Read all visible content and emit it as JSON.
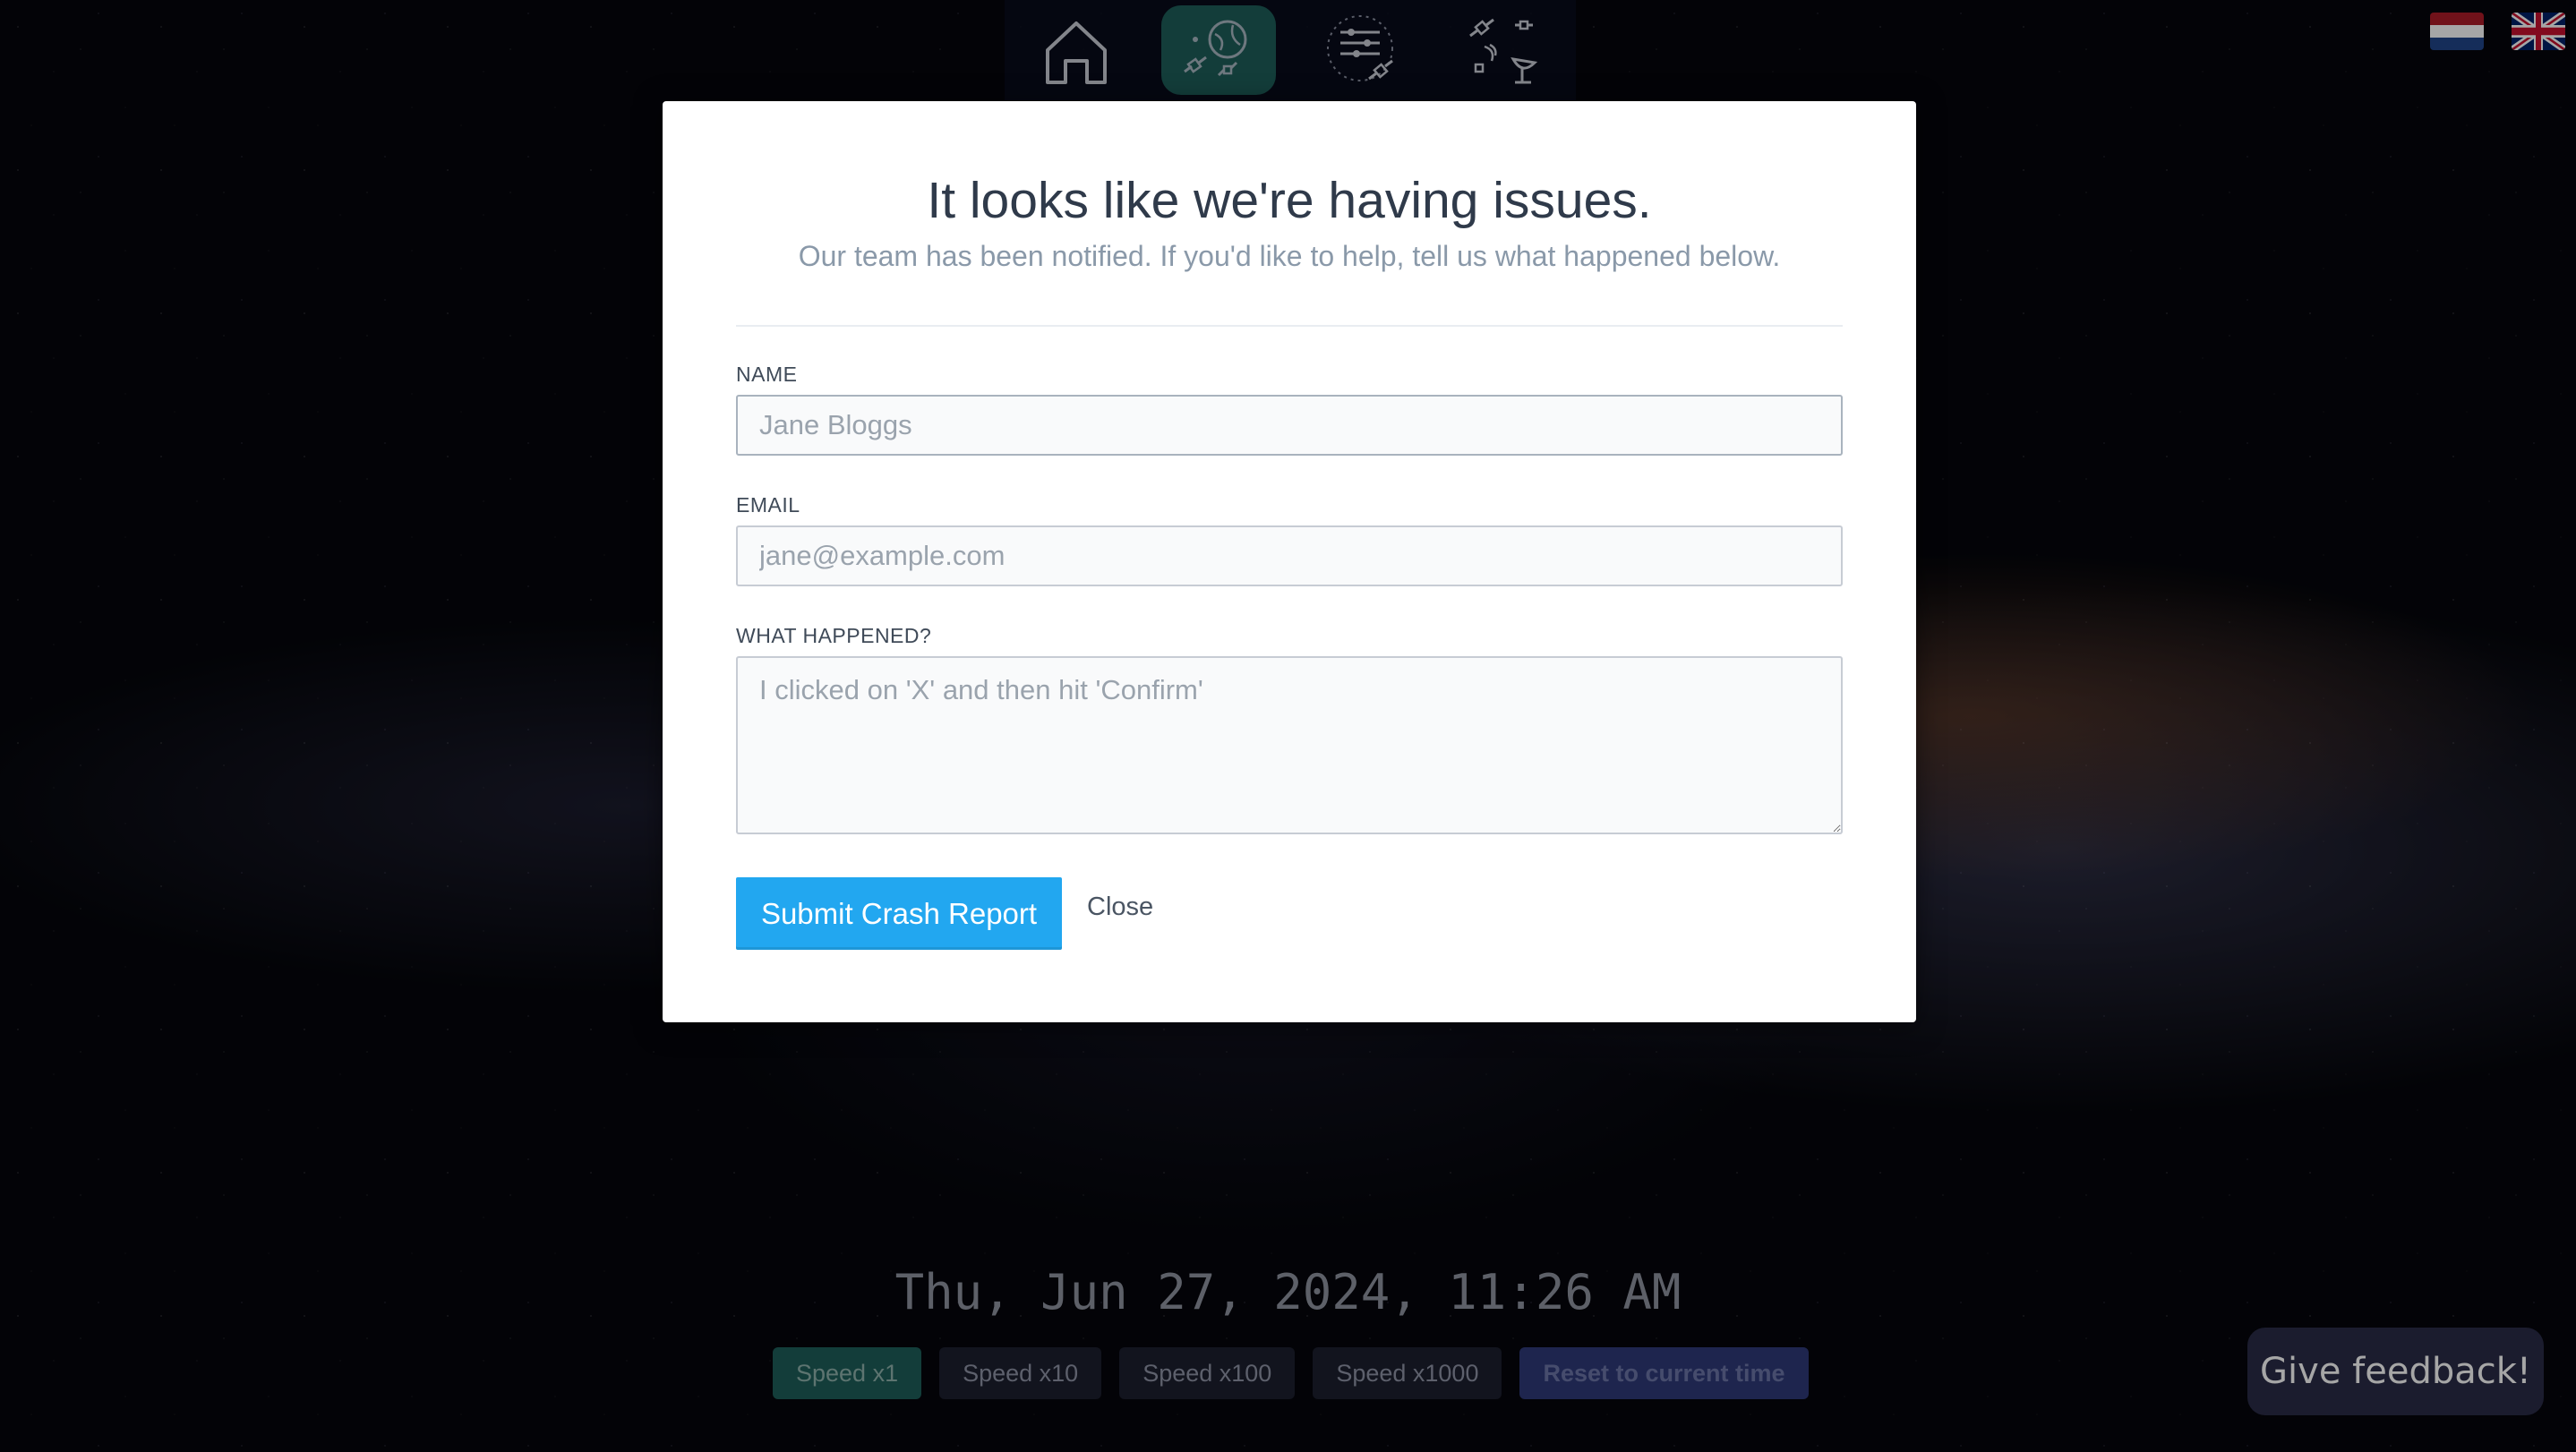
{
  "nav": {
    "items": [
      {
        "name": "home",
        "icon": "home-icon",
        "active": false
      },
      {
        "name": "earth-satellites",
        "icon": "earth-satellites-icon",
        "active": true
      },
      {
        "name": "controls",
        "icon": "sliders-satellite-icon",
        "active": false
      },
      {
        "name": "ground-stations",
        "icon": "satellite-dish-icon",
        "active": false
      }
    ]
  },
  "flags": [
    "nl-flag-icon",
    "uk-flag-icon"
  ],
  "modal": {
    "title": "It looks like we're having issues.",
    "subtitle": "Our team has been notified. If you'd like to help, tell us what happened below.",
    "name_label": "NAME",
    "name_placeholder": "Jane Bloggs",
    "email_label": "EMAIL",
    "email_placeholder": "jane@example.com",
    "what_label": "WHAT HAPPENED?",
    "what_placeholder": "I clicked on 'X' and then hit 'Confirm'",
    "submit_label": "Submit Crash Report",
    "close_label": "Close"
  },
  "datetime": "Thu, Jun 27, 2024, 11:26 AM",
  "speed": {
    "buttons": [
      "Speed x1",
      "Speed x10",
      "Speed x100",
      "Speed x1000"
    ],
    "active_index": 0,
    "reset_label": "Reset to current time"
  },
  "feedback_label": "Give feedback!",
  "colors": {
    "accent_blue": "#22a7f0",
    "active_teal": "#1e5f5a",
    "reset_indigo": "#2f3a78"
  }
}
